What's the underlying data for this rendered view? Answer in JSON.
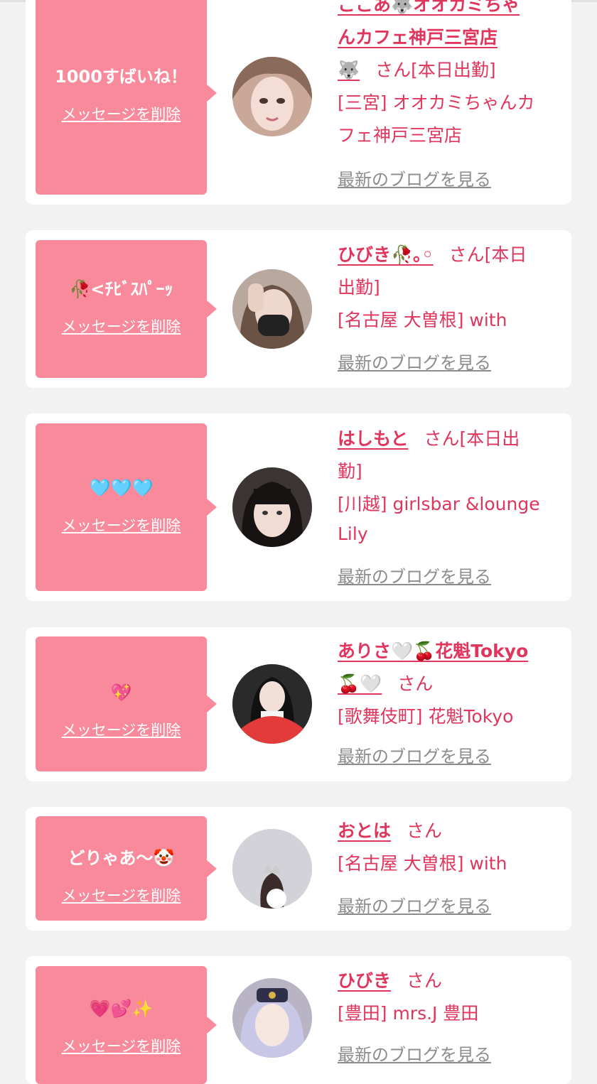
{
  "delete_label": "メッセージを削除",
  "blog_label": "最新のブログを見る",
  "accent_color": "#e0355c",
  "bubble_color": "#f88a9b",
  "cards": [
    {
      "message": "1000すばいね！",
      "name_lines": [
        "ここあ🐺オオカミちゃ",
        "んカフェ神戸三宮店"
      ],
      "name_tail": "🐺",
      "san_suffix": "さん[本日出勤]",
      "store_lines": [
        "[三宮] オオカミちゃんカ",
        "フェ神戸三宮店"
      ]
    },
    {
      "message": "🥀<ﾁﾋﾞｽﾊﾟｰｯ",
      "name": "ひびき🥀｡◦",
      "san_suffix": "さん[本日",
      "status_line": "出勤]",
      "store_lines": [
        "[名古屋 大曽根] with"
      ]
    },
    {
      "message": "🩵🩵🩵",
      "name": "はしもと",
      "san_suffix": "さん[本日出",
      "status_line": "勤]",
      "store_lines": [
        "[川越] girlsbar &lounge",
        "Lily"
      ]
    },
    {
      "message": "💖",
      "name_lines": [
        "ありさ🤍🍒花魁Tokyo"
      ],
      "name_tail": "🍒🤍",
      "san_suffix": "さん",
      "store_lines": [
        "[歌舞伎町] 花魁Tokyo"
      ]
    },
    {
      "message": "どりゃあ〜🤡",
      "name": "おとは",
      "san_suffix": "さん",
      "store_lines": [
        "[名古屋 大曽根] with"
      ]
    },
    {
      "message": "💗💕✨",
      "name": "ひびき",
      "san_suffix": "さん",
      "store_lines": [
        "[豊田] mrs.J 豊田"
      ]
    }
  ]
}
